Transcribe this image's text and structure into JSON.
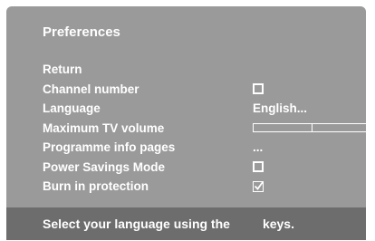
{
  "menu": {
    "title": "Preferences",
    "items": [
      {
        "label": "Return",
        "value": ""
      },
      {
        "label": "Channel number",
        "value": ""
      },
      {
        "label": "Language",
        "value": "English..."
      },
      {
        "label": "Maximum TV volume",
        "value": ""
      },
      {
        "label": "Programme info pages",
        "value": "..."
      },
      {
        "label": "Power Savings Mode",
        "value": ""
      },
      {
        "label": "Burn in protection",
        "value": ""
      }
    ],
    "channel_number_checked": false,
    "power_savings_checked": false,
    "burn_in_checked": true,
    "max_volume_fraction": 0.5
  },
  "footer": {
    "hint_before": "Select your language using the",
    "hint_after": "keys."
  },
  "colors": {
    "background": "#9a9a9a",
    "footer": "#6d6d6d",
    "text": "#ffffff"
  },
  "icons": {
    "unchecked": "checkbox-empty",
    "checked": "checkbox-checked"
  }
}
